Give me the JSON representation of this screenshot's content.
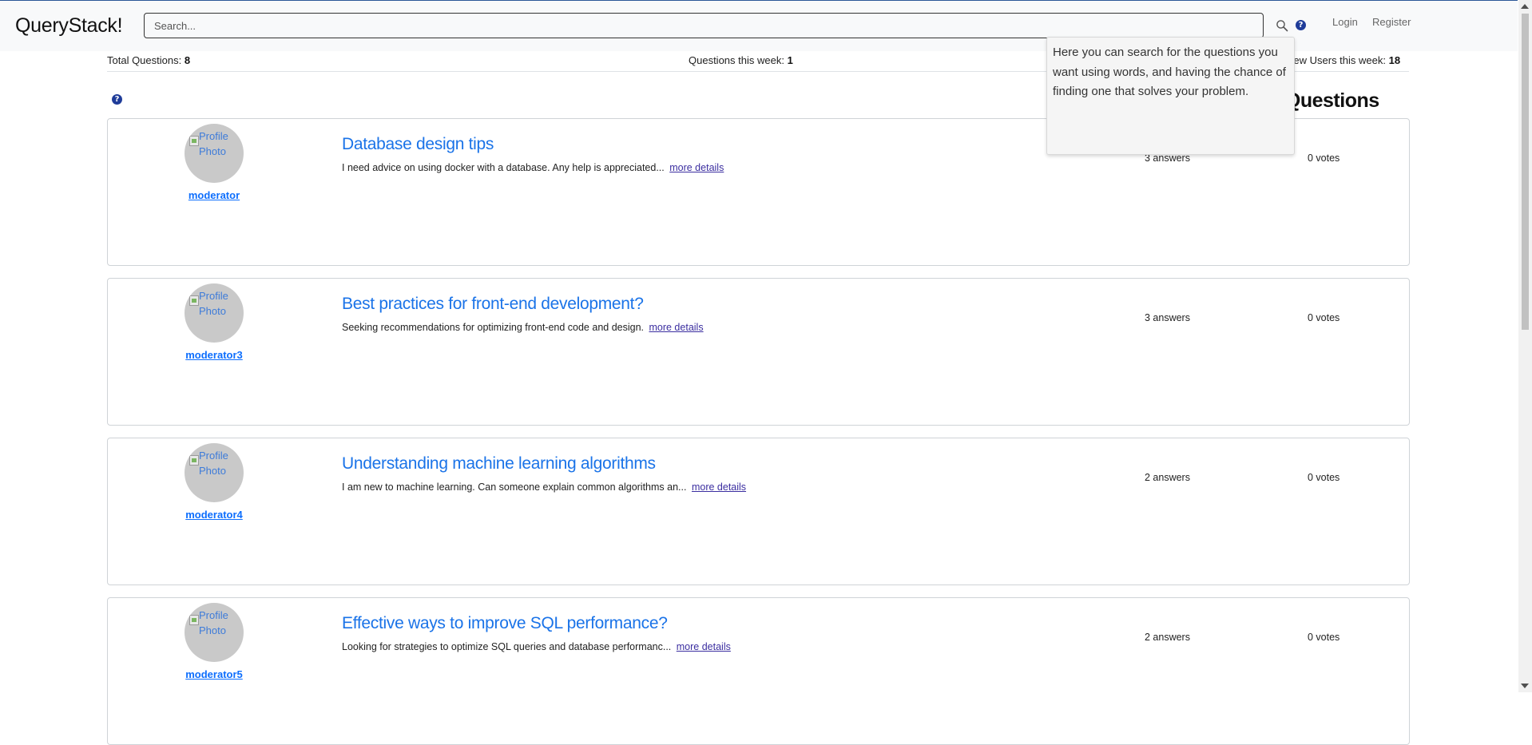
{
  "header": {
    "brand": "QueryStack!",
    "search_placeholder": "Search...",
    "help_glyph": "?",
    "login_label": "Login",
    "register_label": "Register"
  },
  "stats": {
    "total_label": "Total Questions:",
    "total_value": "8",
    "week_label": "Questions this week:",
    "week_value": "1",
    "users_label": "New Users this week:",
    "users_value": "18"
  },
  "main": {
    "help_glyph": "?",
    "section_title": "Top Questions"
  },
  "tooltip": {
    "text": "Here you can search for the questions you want using words, and having the chance of finding one that solves your problem."
  },
  "questions": [
    {
      "avatar_alt": "Profile Photo",
      "author": "moderator",
      "title": "Database design tips",
      "excerpt": "I need advice on using docker with a database. Any help is appreciated...",
      "more": "more details",
      "answers": "3 answers",
      "votes": "0 votes"
    },
    {
      "avatar_alt": "Profile Photo",
      "author": "moderator3",
      "title": "Best practices for front-end development?",
      "excerpt": "Seeking recommendations for optimizing front-end code and design.",
      "more": "more details",
      "answers": "3 answers",
      "votes": "0 votes"
    },
    {
      "avatar_alt": "Profile Photo",
      "author": "moderator4",
      "title": "Understanding machine learning algorithms",
      "excerpt": "I am new to machine learning. Can someone explain common algorithms an...",
      "more": "more details",
      "answers": "2 answers",
      "votes": "0 votes"
    },
    {
      "avatar_alt": "Profile Photo",
      "author": "moderator5",
      "title": "Effective ways to improve SQL performance?",
      "excerpt": "Looking for strategies to optimize SQL queries and database performanc...",
      "more": "more details",
      "answers": "2 answers",
      "votes": "0 votes"
    }
  ],
  "icons": {
    "search": "search-icon",
    "help": "question-circle-icon"
  },
  "colors": {
    "brand_link": "#1a73e8",
    "help_icon": "#1f3c99",
    "navbar_bg": "#f8f9fa"
  }
}
